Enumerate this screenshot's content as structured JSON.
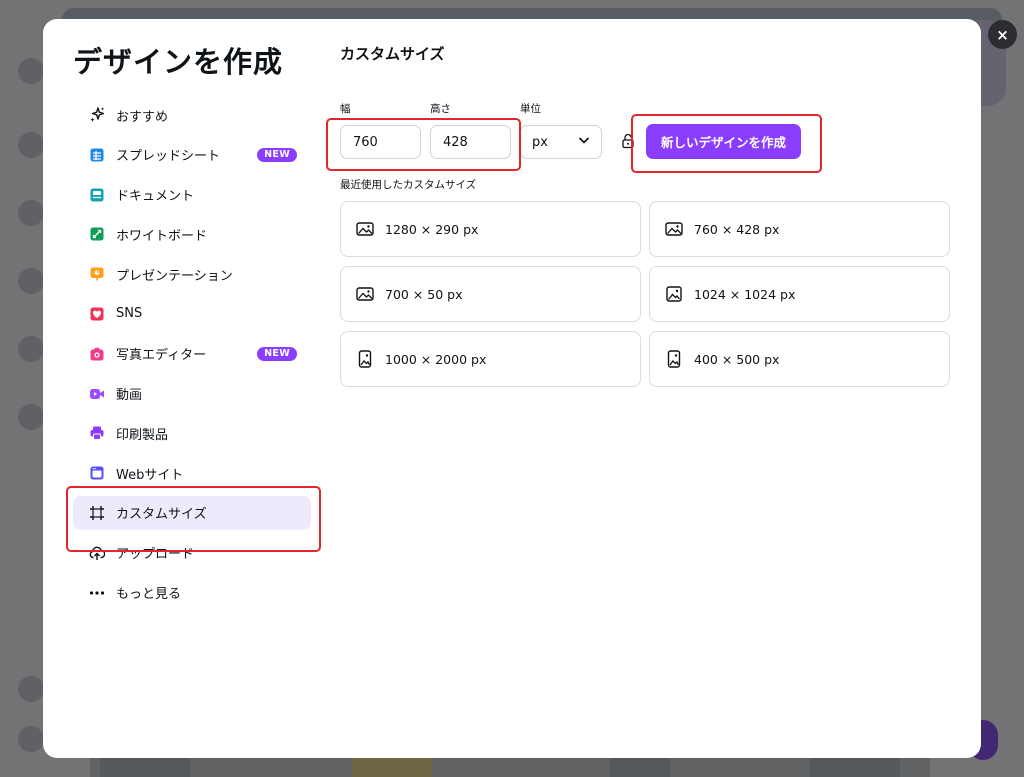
{
  "dialog": {
    "title": "デザインを作成",
    "close_label": "×"
  },
  "sidebar": {
    "items": [
      {
        "label": "おすすめ",
        "icon": "sparkle-icon",
        "color": "#0e1318"
      },
      {
        "label": "スプレッドシート",
        "icon": "spreadsheet-icon",
        "color": "#1e88e5",
        "badge": "NEW"
      },
      {
        "label": "ドキュメント",
        "icon": "document-icon",
        "color": "#13a3b5"
      },
      {
        "label": "ホワイトボード",
        "icon": "whiteboard-icon",
        "color": "#0f9d58"
      },
      {
        "label": "プレゼンテーション",
        "icon": "presentation-icon",
        "color": "#ff9f1a"
      },
      {
        "label": "SNS",
        "icon": "heart-icon",
        "color": "#f0325a"
      },
      {
        "label": "写真エディター",
        "icon": "camera-icon",
        "color": "#f23c8b",
        "badge": "NEW"
      },
      {
        "label": "動画",
        "icon": "video-icon",
        "color": "#9b4dff"
      },
      {
        "label": "印刷製品",
        "icon": "printer-icon",
        "color": "#8b3dff"
      },
      {
        "label": "Webサイト",
        "icon": "website-icon",
        "color": "#5b4dff"
      },
      {
        "label": "カスタムサイズ",
        "icon": "custom-size-icon",
        "color": "#0e1318",
        "active": true
      },
      {
        "label": "アップロード",
        "icon": "upload-icon",
        "color": "#0e1318"
      },
      {
        "label": "もっと見る",
        "icon": "more-icon",
        "color": "#0e1318"
      }
    ]
  },
  "custom_size": {
    "title": "カスタムサイズ",
    "width_label": "幅",
    "height_label": "高さ",
    "unit_label": "単位",
    "width_value": "760",
    "height_value": "428",
    "unit_value": "px",
    "create_button": "新しいデザインを作成",
    "recent_label": "最近使用したカスタムサイズ",
    "recent": [
      {
        "text": "1280 × 290 px",
        "icon": "landscape-image-icon"
      },
      {
        "text": "760 × 428 px",
        "icon": "landscape-image-icon"
      },
      {
        "text": "700 × 50 px",
        "icon": "landscape-image-icon"
      },
      {
        "text": "1024 × 1024 px",
        "icon": "square-image-icon"
      },
      {
        "text": "1000 × 2000 px",
        "icon": "portrait-image-icon"
      },
      {
        "text": "400 × 500 px",
        "icon": "portrait-image-icon"
      }
    ]
  },
  "colors": {
    "accent": "#8b3dff",
    "active_nav_bg": "#efe9fc",
    "highlight": "#e2262b"
  }
}
